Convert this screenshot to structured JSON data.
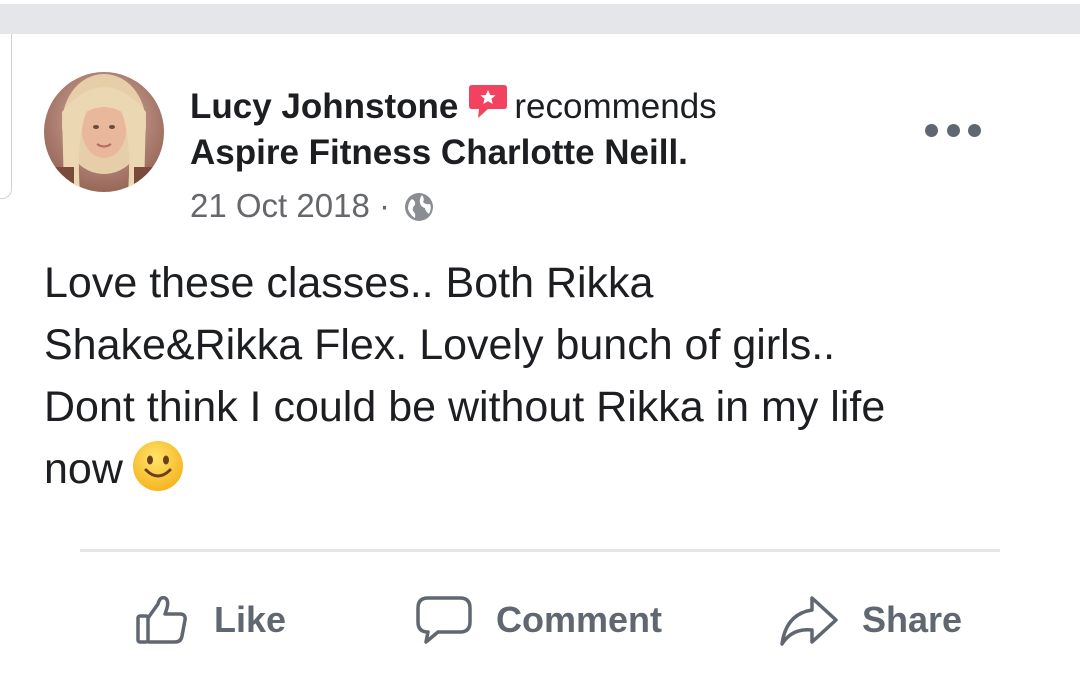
{
  "post": {
    "author": "Lucy Johnstone",
    "verb": "recommends",
    "page": "Aspire Fitness Charlotte Neill.",
    "date": "21 Oct 2018",
    "separator": "·",
    "privacy_icon": "globe-icon",
    "text_parts": [
      "Love these classes.. Both Rikka",
      "Shake&Rikka Flex. Lovely bunch of girls..",
      "Dont think I could be without Rikka in my life",
      "now"
    ],
    "emoji": "smiling-face-emoji"
  },
  "actions": {
    "like": "Like",
    "comment": "Comment",
    "share": "Share"
  },
  "colors": {
    "recommend_badge": "#f3425f",
    "meta_text": "#65676b",
    "action_text": "#606770",
    "divider": "#e4e6ea"
  }
}
